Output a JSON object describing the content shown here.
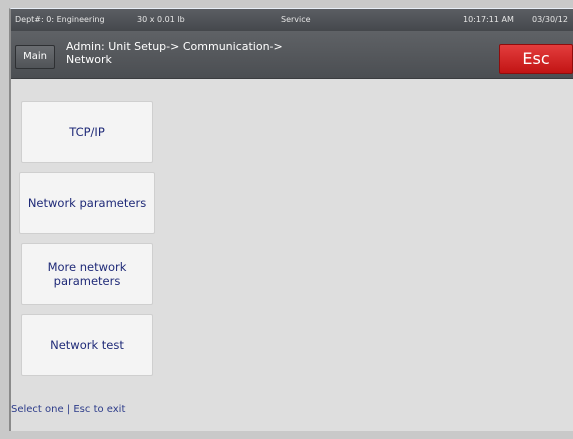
{
  "status_bar": {
    "dept": "Dept#: 0: Engineering",
    "capacity": "30 x 0.01 lb",
    "mode": "Service",
    "time": "10:17:11 AM",
    "date": "03/30/12"
  },
  "header": {
    "main_label": "Main",
    "breadcrumb_line1": "Admin: Unit Setup-> Communication->",
    "breadcrumb_line2": "Network",
    "esc_label": "Esc"
  },
  "menu": {
    "items": [
      {
        "label": "TCP/IP"
      },
      {
        "label": "Network parameters"
      },
      {
        "label_line1": "More network",
        "label_line2": "parameters"
      },
      {
        "label": "Network test"
      }
    ]
  },
  "footer": {
    "hint": "Select one | Esc to exit"
  },
  "colors": {
    "esc_button": "#d12020",
    "menu_text": "#1f2a78",
    "background": "#dedede"
  }
}
